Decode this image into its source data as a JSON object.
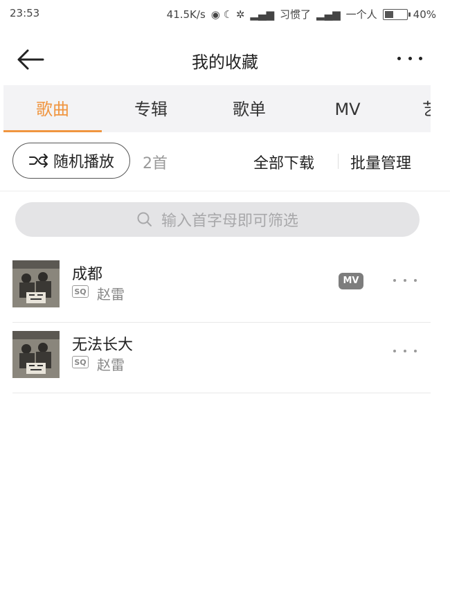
{
  "status_bar": {
    "time": "23:53",
    "network_speed": "41.5K/s",
    "carrier1": "习惯了",
    "carrier2": "一个人",
    "battery": "40%"
  },
  "header": {
    "title": "我的收藏"
  },
  "tabs": [
    {
      "label": "歌曲",
      "active": true
    },
    {
      "label": "专辑",
      "active": false
    },
    {
      "label": "歌单",
      "active": false
    },
    {
      "label": "MV",
      "active": false
    },
    {
      "label": "艺",
      "active": false
    }
  ],
  "actions": {
    "shuffle_label": "随机播放",
    "count": "2首",
    "download_all": "全部下载",
    "batch_manage": "批量管理"
  },
  "search": {
    "placeholder": "输入首字母即可筛选"
  },
  "songs": [
    {
      "title": "成都",
      "quality": "SQ",
      "artist": "赵雷",
      "has_mv": true,
      "mv_label": "MV"
    },
    {
      "title": "无法长大",
      "quality": "SQ",
      "artist": "赵雷",
      "has_mv": false
    }
  ],
  "colors": {
    "accent": "#f0953f"
  }
}
